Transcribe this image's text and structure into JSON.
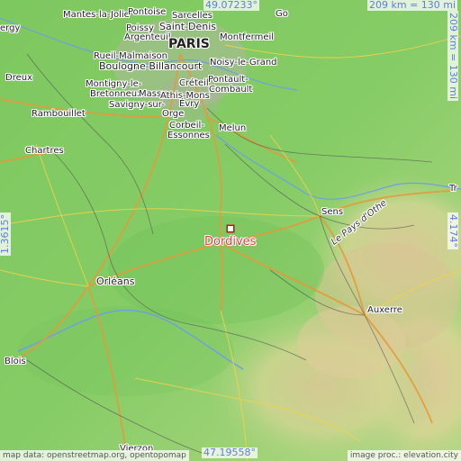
{
  "map": {
    "focus_place": "Dordives",
    "coords": {
      "north": "49.07233°",
      "south": "47.19558°",
      "west": "1.3615°",
      "east": "4.174°"
    },
    "scale": {
      "horizontal": "209 km = 130 mi",
      "vertical": "209 km = 130 mi"
    },
    "attribution": {
      "left": "map data: openstreetmap.org, opentopomap",
      "right": "image proc.: elevation.city"
    },
    "places": [
      {
        "key": "mantes",
        "label": "Mantes-la-Jolie"
      },
      {
        "key": "pontoise",
        "label": "Pontoise"
      },
      {
        "key": "sarcelles",
        "label": "Sarcelles"
      },
      {
        "key": "poissy",
        "label": "Poissy"
      },
      {
        "key": "saintdenis",
        "label": "Saint-Denis"
      },
      {
        "key": "argenteuil",
        "label": "Argenteuil"
      },
      {
        "key": "paris",
        "label": "PARIS"
      },
      {
        "key": "montfermeil",
        "label": "Montfermeil"
      },
      {
        "key": "rueil",
        "label": "Rueil-Malmaison"
      },
      {
        "key": "boulogne",
        "label": "Boulogne-Billancourt"
      },
      {
        "key": "noisy",
        "label": "Noisy-le-Grand"
      },
      {
        "key": "dreux",
        "label": "Dreux"
      },
      {
        "key": "montigny",
        "label": "Montigny-le-"
      },
      {
        "key": "bretonneux",
        "label": "Bretonneux"
      },
      {
        "key": "creteil",
        "label": "Créteil"
      },
      {
        "key": "pontault",
        "label": "Pontault-"
      },
      {
        "key": "combault",
        "label": "Combault"
      },
      {
        "key": "massy",
        "label": "Massy"
      },
      {
        "key": "athis",
        "label": "Athis-Mons"
      },
      {
        "key": "savigny",
        "label": "Savigny-sur-"
      },
      {
        "key": "orge",
        "label": "Orge"
      },
      {
        "key": "evry",
        "label": "Évry"
      },
      {
        "key": "rambouillet",
        "label": "Rambouillet"
      },
      {
        "key": "corbeil",
        "label": "Corbeil-"
      },
      {
        "key": "essonnes",
        "label": "Essonnes"
      },
      {
        "key": "melun",
        "label": "Melun"
      },
      {
        "key": "chartres",
        "label": "Chartres"
      },
      {
        "key": "sens",
        "label": "Sens"
      },
      {
        "key": "troyes",
        "label": "Tr"
      },
      {
        "key": "orleans",
        "label": "Orléans"
      },
      {
        "key": "auxerre",
        "label": "Auxerre"
      },
      {
        "key": "blois",
        "label": "Blois"
      },
      {
        "key": "vierzon",
        "label": "Vierzon"
      },
      {
        "key": "paysotheregion",
        "label": "Le Pays d'Othe"
      },
      {
        "key": "go",
        "label": "Go"
      },
      {
        "key": "ergy",
        "label": "ergy"
      }
    ]
  }
}
